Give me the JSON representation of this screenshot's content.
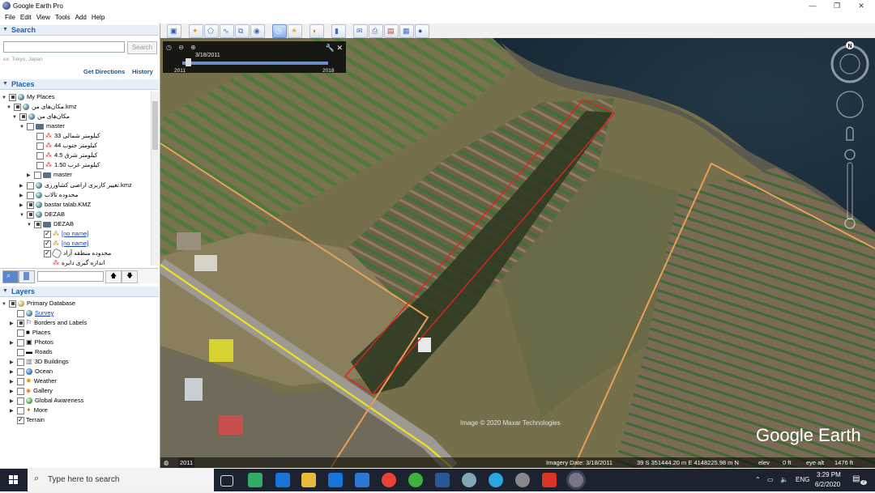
{
  "window": {
    "title": "Google Earth Pro"
  },
  "menu": [
    "File",
    "Edit",
    "View",
    "Tools",
    "Add",
    "Help"
  ],
  "search": {
    "header": "Search",
    "placeholder": "",
    "button": "Search",
    "hint": "ex: Tokyo, Japan",
    "get_directions": "Get Directions",
    "history": "History"
  },
  "places": {
    "header": "Places",
    "items": [
      {
        "label": "My Places"
      },
      {
        "label": "مکان‌های من.kmz"
      },
      {
        "label": "مکان‌های من"
      },
      {
        "label": "master"
      },
      {
        "label": "کیلومتر شمالی 33"
      },
      {
        "label": "کیلومتر جنوب 44"
      },
      {
        "label": "کیلومتر شرق 4.5"
      },
      {
        "label": "کیلومتر غرب 1.50"
      },
      {
        "label": "master"
      },
      {
        "label": "تغییر کاربری اراضی کشاورزی.kmz"
      },
      {
        "label": "محدوده تالاب"
      },
      {
        "label": "bastar talab.KMZ"
      },
      {
        "label": "DEZAB"
      },
      {
        "label": "DEZAB"
      },
      {
        "label": "[no name]"
      },
      {
        "label": "[no name]"
      },
      {
        "label": "محدوده منطقه آزاد"
      },
      {
        "label": "اندازه گیری دایره"
      }
    ]
  },
  "layers": {
    "header": "Layers",
    "items": [
      {
        "label": "Primary Database"
      },
      {
        "label": "Survey"
      },
      {
        "label": "Borders and Labels"
      },
      {
        "label": "Places"
      },
      {
        "label": "Photos"
      },
      {
        "label": "Roads"
      },
      {
        "label": "3D Buildings"
      },
      {
        "label": "Ocean"
      },
      {
        "label": "Weather"
      },
      {
        "label": "Gallery"
      },
      {
        "label": "Global Awareness"
      },
      {
        "label": "More"
      },
      {
        "label": "Terrain"
      }
    ]
  },
  "timeslider": {
    "date": "3/18/2011",
    "start_year": "2011",
    "end_year": "2018"
  },
  "map": {
    "imagery_credit": "Image © 2020 Maxar Technologies",
    "logo": "Google Earth",
    "year_badge": "2011",
    "status": {
      "imagery_date": "Imagery Date: 3/18/2011",
      "coords": "39 S 351444.20 m E 4148225.98 m N",
      "elev": "elev",
      "elev_value": "0 ft",
      "eye_alt": "eye alt",
      "eye_alt_value": "1476 ft"
    }
  },
  "taskbar": {
    "search_placeholder": "Type here to search",
    "lang": "ENG",
    "time": "3:29 PM",
    "date": "6/2/2020",
    "notification_count": "7"
  }
}
